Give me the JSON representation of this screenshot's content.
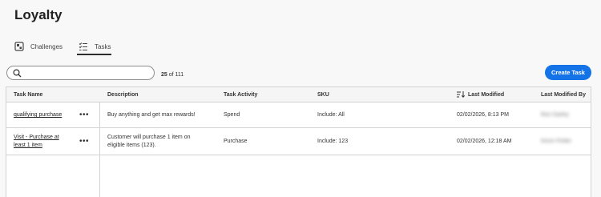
{
  "page": {
    "title": "Loyalty"
  },
  "tabs": [
    {
      "label": "Challenges",
      "icon": "challenges-icon"
    },
    {
      "label": "Tasks",
      "icon": "tasks-list-icon",
      "selected": true
    }
  ],
  "search": {
    "placeholder": "",
    "value": ""
  },
  "count": {
    "shown": "25",
    "of_label": "of 111"
  },
  "create_button": {
    "label": "Create Task",
    "color": "#1473e6"
  },
  "table": {
    "columns": [
      "Task Name",
      "Description",
      "Task Activity",
      "SKU",
      "Last Modified",
      "Last Modified By"
    ],
    "sort_column": "Last Modified",
    "rows": [
      {
        "name": "qualifying purchase",
        "description": "Buy anything and get max rewards!",
        "activity": "Spend",
        "sku": "Include: All",
        "last_modified": "02/02/2026, 8:13 PM",
        "modified_by": "Ron Darley"
      },
      {
        "name_line1": "Visit - Purchase at",
        "name_line2": "least 1 item",
        "description_line1": "Customer will purchase 1 item on",
        "description_line2": "eligible items (123).",
        "activity": "Purchase",
        "sku": "Include: 123",
        "last_modified": "02/02/2026, 12:18 AM",
        "modified_by": "Kevin Potter"
      }
    ]
  }
}
